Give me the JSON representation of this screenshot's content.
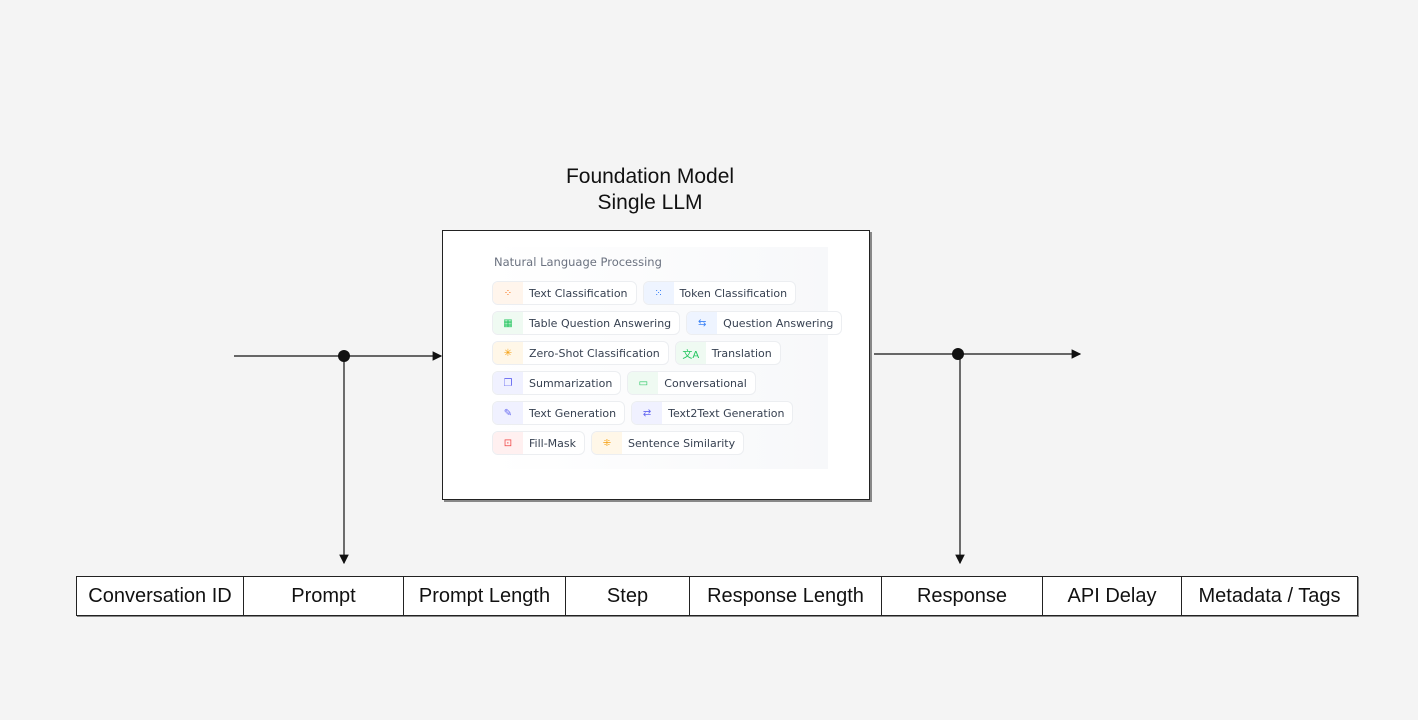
{
  "diagram": {
    "title_line1": "Foundation Model",
    "title_line2": "Single LLM",
    "panel": {
      "heading": "Natural Language Processing",
      "rows": [
        [
          {
            "label": "Text Classification",
            "icon": "text-classification-icon",
            "glyph": "⁘",
            "color": "#f97316",
            "bg": "#fff5ec"
          },
          {
            "label": "Token Classification",
            "icon": "token-classification-icon",
            "glyph": "⁙",
            "color": "#3b82f6",
            "bg": "#eef4ff"
          }
        ],
        [
          {
            "label": "Table Question Answering",
            "icon": "table-icon",
            "glyph": "▦",
            "color": "#22c55e",
            "bg": "#effaf2"
          },
          {
            "label": "Question Answering",
            "icon": "question-answering-icon",
            "glyph": "⇆",
            "color": "#3b82f6",
            "bg": "#eef4ff"
          }
        ],
        [
          {
            "label": "Zero-Shot Classification",
            "icon": "zero-shot-icon",
            "glyph": "✳",
            "color": "#f59e0b",
            "bg": "#fff7e8"
          },
          {
            "label": "Translation",
            "icon": "translation-icon",
            "glyph": "文A",
            "color": "#22c55e",
            "bg": "#effaf2"
          }
        ],
        [
          {
            "label": "Summarization",
            "icon": "summarization-icon",
            "glyph": "❐",
            "color": "#6366f1",
            "bg": "#f0f1ff"
          },
          {
            "label": "Conversational",
            "icon": "conversational-icon",
            "glyph": "▭",
            "color": "#22c55e",
            "bg": "#effaf2"
          }
        ],
        [
          {
            "label": "Text Generation",
            "icon": "text-generation-icon",
            "glyph": "✎",
            "color": "#6366f1",
            "bg": "#f0f1ff"
          },
          {
            "label": "Text2Text Generation",
            "icon": "text2text-icon",
            "glyph": "⇄",
            "color": "#6366f1",
            "bg": "#f0f1ff"
          }
        ],
        [
          {
            "label": "Fill-Mask",
            "icon": "fill-mask-icon",
            "glyph": "⊡",
            "color": "#ef4444",
            "bg": "#fff0f0"
          },
          {
            "label": "Sentence Similarity",
            "icon": "sentence-similarity-icon",
            "glyph": "⁜",
            "color": "#f59e0b",
            "bg": "#fff7e8"
          }
        ]
      ]
    },
    "table_columns": [
      "Conversation ID",
      "Prompt",
      "Prompt Length",
      "Step",
      "Response Length",
      "Response",
      "API Delay",
      "Metadata / Tags"
    ]
  }
}
